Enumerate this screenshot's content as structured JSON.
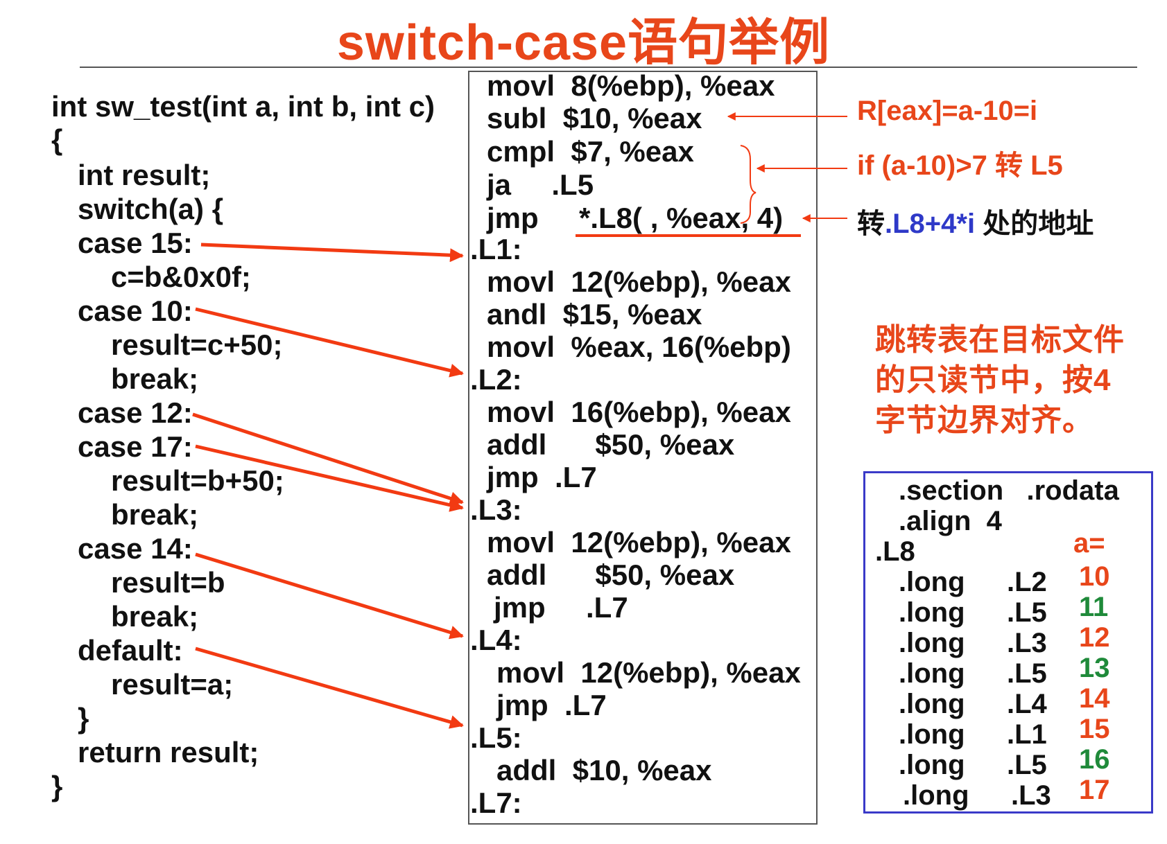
{
  "title": "switch-case语句举例",
  "c_code": [
    "int sw_test(int a, int b, int c)",
    "{",
    "int result;",
    "switch(a) {",
    "case 15:",
    "c=b&0x0f;",
    "case 10:",
    "result=c+50;",
    "break;",
    "case 12:",
    "case 17:",
    "result=b+50;",
    "break;",
    "case 14:",
    "result=b",
    "break;",
    "default:",
    "result=a;",
    "}",
    "return result;",
    "}"
  ],
  "asm_code": [
    "movl  8(%ebp), %eax",
    "subl  $10, %eax",
    "cmpl  $7, %eax",
    "ja     .L5",
    "jmp     *.L8( , %eax, 4)",
    ".L1:",
    "movl  12(%ebp), %eax",
    "andl  $15, %eax",
    "movl  %eax, 16(%ebp)",
    ".L2:",
    "movl  16(%ebp), %eax",
    "addl      $50, %eax",
    "jmp  .L7",
    ".L3:",
    "movl  12(%ebp), %eax",
    "addl      $50, %eax",
    "jmp     .L7",
    ".L4:",
    "movl  12(%ebp), %eax",
    "jmp  .L7",
    ".L5:",
    "addl  $10, %eax",
    ".L7:"
  ],
  "annotations": {
    "eax": "R[eax]=a-10=i",
    "cmp": "if (a-10)>7 转 L5",
    "jmp_prefix": "转",
    "jmp_expr": ".L8+4*i",
    "jmp_suffix": " 处的地址"
  },
  "note": [
    "跳转表在目标文件",
    "的只读节中，按4",
    "字节边界对齐。"
  ],
  "rodata": {
    "section": ".section   .rodata",
    "align": ".align  4",
    "label": ".L8",
    "a_header": "a=",
    "rows": [
      {
        "directive": ".long",
        "target": ".L2",
        "a": "10",
        "color": "#e8461a"
      },
      {
        "directive": ".long",
        "target": ".L5",
        "a": "11",
        "color": "#1f8a3a"
      },
      {
        "directive": ".long",
        "target": ".L3",
        "a": "12",
        "color": "#e8461a"
      },
      {
        "directive": ".long",
        "target": ".L5",
        "a": "13",
        "color": "#1f8a3a"
      },
      {
        "directive": ".long",
        "target": ".L4",
        "a": "14",
        "color": "#e8461a"
      },
      {
        "directive": ".long",
        "target": ".L1",
        "a": "15",
        "color": "#e8461a"
      },
      {
        "directive": ".long",
        "target": ".L5",
        "a": "16",
        "color": "#1f8a3a"
      },
      {
        "directive": ".long",
        "target": ".L3",
        "a": "17",
        "color": "#e8461a"
      }
    ]
  },
  "colors": {
    "accent": "#e8461a",
    "blue": "#2e39c8",
    "green": "#1f8a3a",
    "box_border": "#3a3ac8"
  }
}
